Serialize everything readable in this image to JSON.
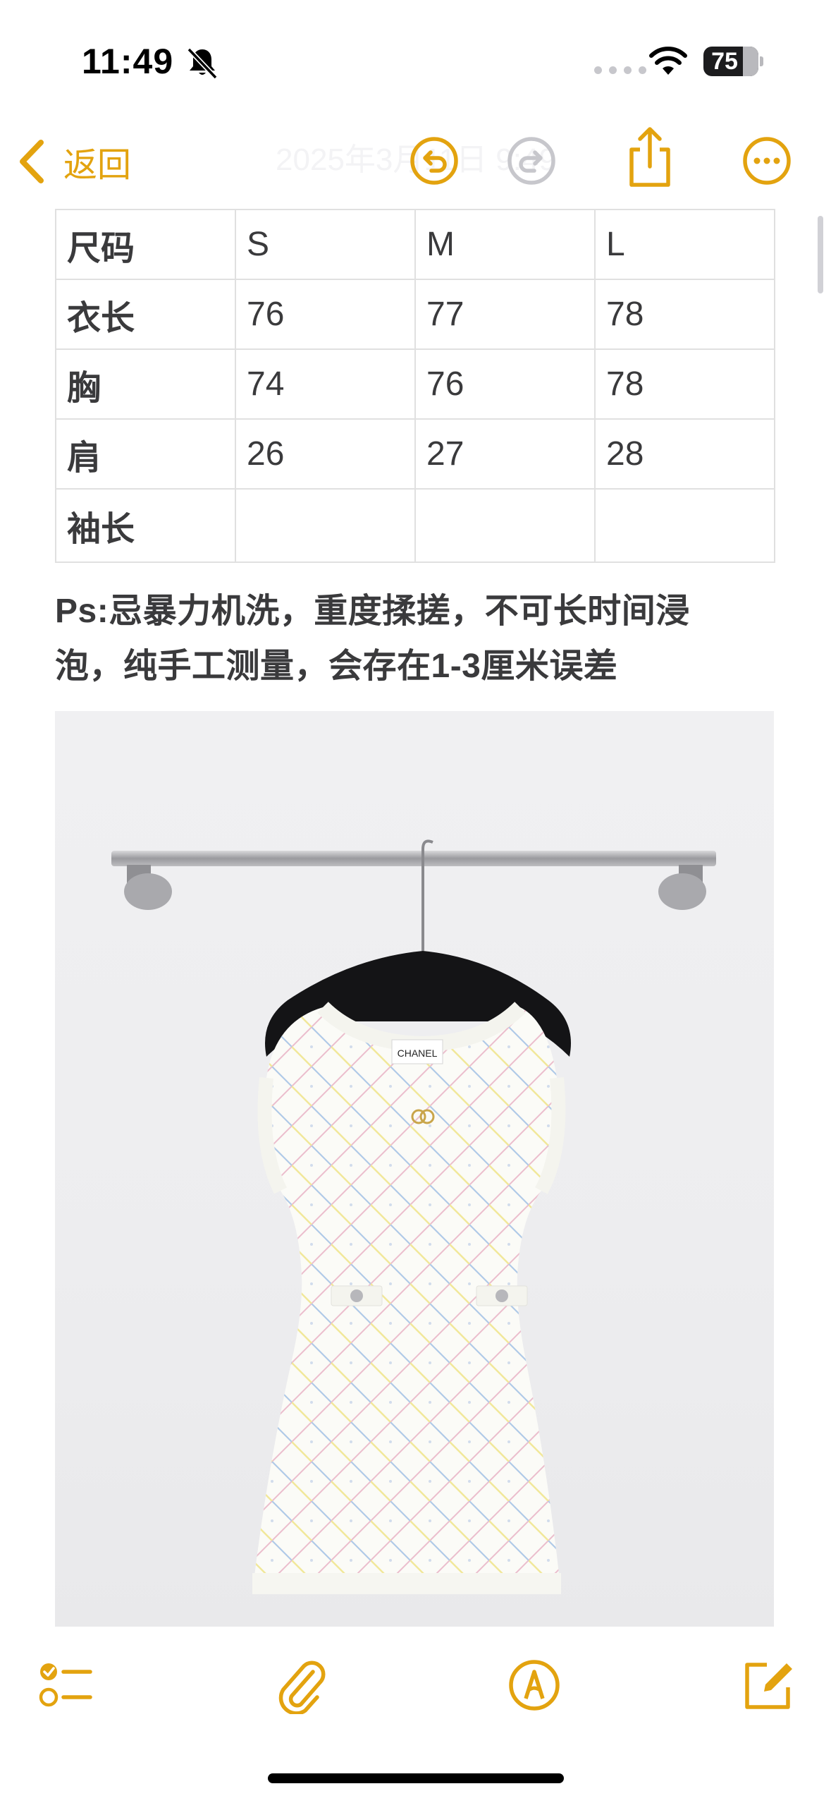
{
  "status_bar": {
    "time": "11:49",
    "battery_percent": "75",
    "battery_level": 0.75,
    "icons": [
      "bell-slash-icon",
      "cellular-signal-icon",
      "wifi-icon",
      "battery-icon"
    ]
  },
  "nav": {
    "back_label": "返回",
    "title": "2025年3月11日 9:49",
    "icons": [
      "chevron-left-icon",
      "undo-icon",
      "redo-icon",
      "share-icon",
      "more-icon"
    ]
  },
  "size_table": {
    "rows": [
      [
        "尺码",
        "S",
        "M",
        "L"
      ],
      [
        "衣长",
        "76",
        "77",
        "78"
      ],
      [
        "胸",
        "74",
        "76",
        "78"
      ],
      [
        "肩",
        "26",
        "27",
        "28"
      ],
      [
        "袖长",
        "",
        "",
        ""
      ]
    ]
  },
  "note": {
    "line1": "Ps:忌暴力机洗，重度揉搓，不可长时间浸",
    "line2": "泡，纯手工测量，会存在1-3厘米误差"
  },
  "photo": {
    "garment_label": "CHANEL"
  },
  "toolbar": {
    "icons": [
      "checklist-icon",
      "paperclip-icon",
      "markup-icon",
      "compose-icon"
    ]
  },
  "colors": {
    "accent": "#e3a30f",
    "text": "#3a3a3c",
    "disabled": "#c7c7cc",
    "table_border": "#e0e0e0"
  }
}
